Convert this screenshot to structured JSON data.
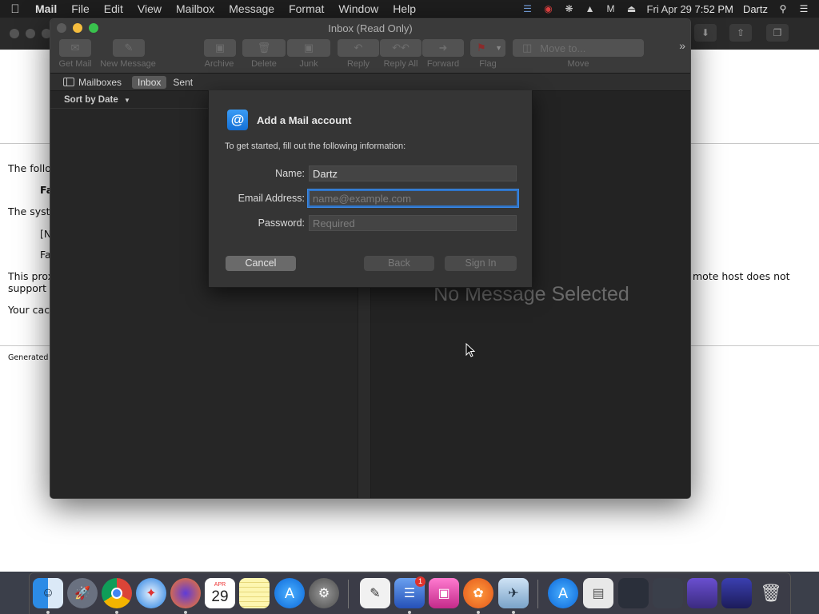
{
  "menubar": {
    "app": "Mail",
    "items": [
      "File",
      "Edit",
      "View",
      "Mailbox",
      "Message",
      "Format",
      "Window",
      "Help"
    ],
    "datetime": "Fri Apr 29  7:52 PM",
    "user": "Dartz"
  },
  "background_page": {
    "lines": [
      "The follo",
      "Fa",
      "The syste",
      "[N",
      "Fa",
      "This prox",
      "support s",
      "Your cac",
      "Generated",
      "mote host does not"
    ]
  },
  "window": {
    "title": "Inbox (Read Only)",
    "toolbar": {
      "get_mail": "Get Mail",
      "new_message": "New Message",
      "archive": "Archive",
      "delete": "Delete",
      "junk": "Junk",
      "reply": "Reply",
      "reply_all": "Reply All",
      "forward": "Forward",
      "flag": "Flag",
      "move_to": "Move to...",
      "move": "Move"
    },
    "favorites": {
      "mailboxes": "Mailboxes",
      "inbox": "Inbox",
      "sent": "Sent"
    },
    "sort_label": "Sort by Date",
    "no_message": "No Message Selected"
  },
  "sheet": {
    "title": "Add a Mail account",
    "subtitle": "To get started, fill out the following information:",
    "name_label": "Name:",
    "name_value": "Dartz",
    "email_label": "Email Address:",
    "email_placeholder": "name@example.com",
    "password_label": "Password:",
    "password_placeholder": "Required",
    "cancel": "Cancel",
    "back": "Back",
    "sign_in": "Sign In"
  },
  "dock": {
    "calendar_month": "APR",
    "calendar_day": "29",
    "badge": "1"
  },
  "colors": {
    "accent": "#2f74c8",
    "window_bg": "#262626",
    "sheet_bg": "#353535"
  }
}
